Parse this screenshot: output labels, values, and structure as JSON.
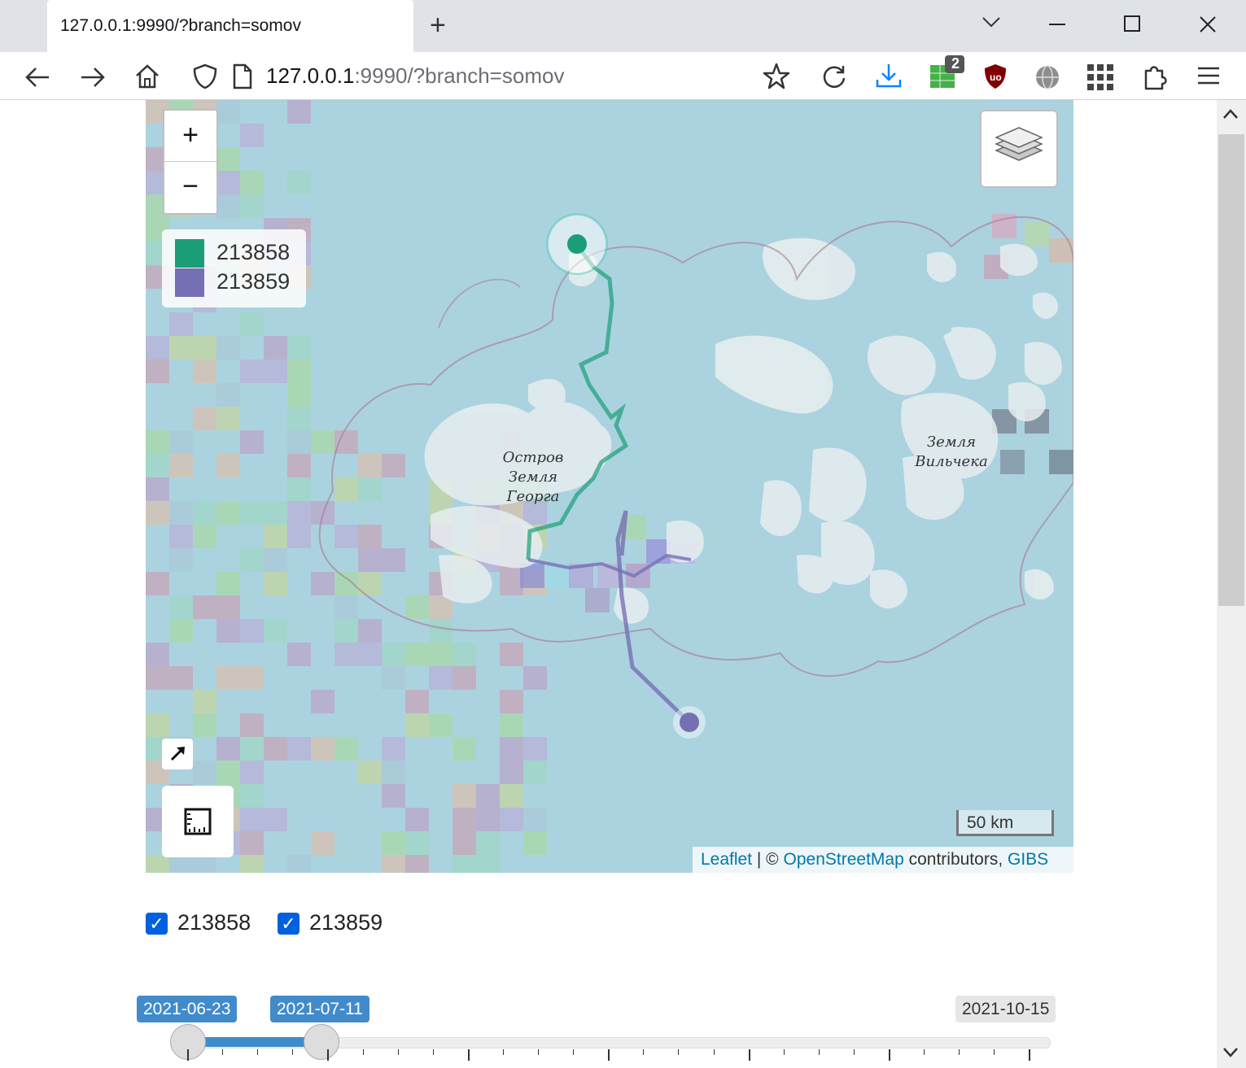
{
  "browser": {
    "tab_title": "127.0.0.1:9990/?branch=somov",
    "url_host": "127.0.0.1",
    "url_rest": ":9990/?branch=somov",
    "extension_badge": "2"
  },
  "map": {
    "zoom_in": "+",
    "zoom_out": "−",
    "legend": [
      {
        "label": "213858",
        "color": "#1b9e77"
      },
      {
        "label": "213859",
        "color": "#7570b3"
      }
    ],
    "place_labels": [
      {
        "lines": [
          "Остров",
          "Земля",
          "Георга"
        ]
      },
      {
        "lines": [
          "Земля",
          "Вильчека"
        ]
      }
    ],
    "scale": "50 km",
    "attribution": {
      "leaflet": "Leaflet",
      "sep": " | © ",
      "osm": "OpenStreetMap",
      "contributors": " contributors, ",
      "gibs": "GIBS"
    }
  },
  "filters": {
    "items": [
      {
        "label": "213858",
        "checked": true
      },
      {
        "label": "213859",
        "checked": true
      }
    ]
  },
  "slider": {
    "from": "2021-06-23",
    "to": "2021-07-11",
    "max": "2021-10-15"
  }
}
